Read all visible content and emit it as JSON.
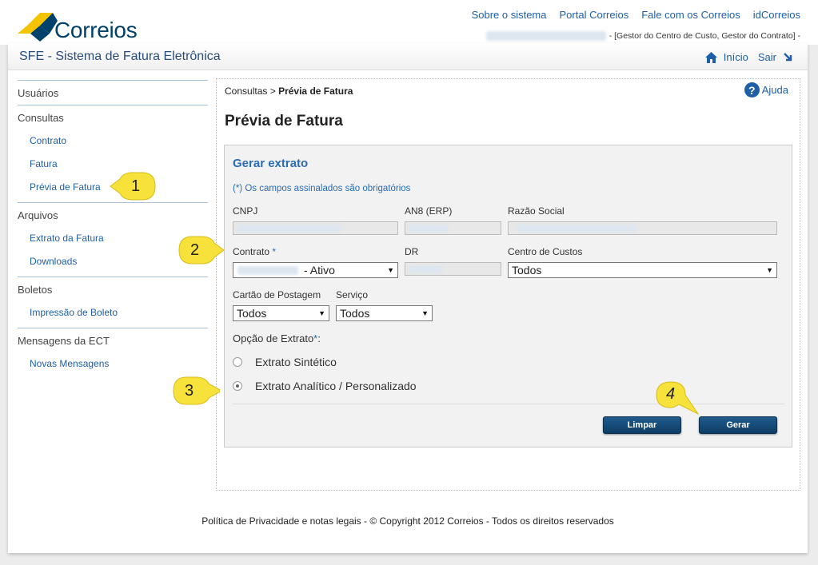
{
  "header": {
    "logo_text": "Correios",
    "links": [
      "Sobre o sistema",
      "Portal Correios",
      "Fale com os Correios",
      "idCorreios"
    ],
    "user_roles": "- [Gestor do Centro de Custo, Gestor do Contrato] -"
  },
  "titlebar": {
    "app_title": "SFE - Sistema de Fatura Eletrônica",
    "home_label": "Início",
    "exit_label": "Sair"
  },
  "sidebar": {
    "sections": [
      {
        "label": "Usuários",
        "items": []
      },
      {
        "label": "Consultas",
        "items": [
          "Contrato",
          "Fatura",
          "Prévia de Fatura"
        ]
      },
      {
        "label": "Arquivos",
        "items": [
          "Extrato da Fatura",
          "Downloads"
        ]
      },
      {
        "label": "Boletos",
        "items": [
          "Impressão de Boleto"
        ]
      },
      {
        "label": "Mensagens da ECT",
        "items": [
          "Novas Mensagens"
        ]
      }
    ]
  },
  "content": {
    "breadcrumb_parent": "Consultas",
    "breadcrumb_sep": ">",
    "breadcrumb_current": "Prévia de Fatura",
    "help_label": "Ajuda",
    "page_title": "Prévia de Fatura"
  },
  "form": {
    "title": "Gerar extrato",
    "required_note": "(*) Os campos assinalados são obrigatórios",
    "cnpj_label": "CNPJ",
    "an8_label": "AN8 (ERP)",
    "razao_label": "Razão Social",
    "contrato_label": "Contrato",
    "required_mark": "*",
    "contrato_value": "- Ativo",
    "dr_label": "DR",
    "centro_label": "Centro de Custos",
    "centro_value": "Todos",
    "cartao_label": "Cartão de Postagem",
    "cartao_value": "Todos",
    "servico_label": "Serviço",
    "servico_value": "Todos",
    "opcao_label": "Opção de Extrato",
    "opcao_suffix": ":",
    "option_sintetico": "Extrato Sintético",
    "option_analitico": "Extrato Analítico / Personalizado",
    "btn_limpar": "Limpar",
    "btn_gerar": "Gerar"
  },
  "footer": {
    "text": "Política de Privacidade e notas legais - © Copyright 2012 Correios - Todos os direitos reservados"
  },
  "callouts": [
    "1",
    "2",
    "3",
    "4"
  ],
  "colors": {
    "link": "#1f5fa8",
    "brand_dark": "#00416b",
    "button": "#0e3e66",
    "callout": "#f7e13b"
  }
}
